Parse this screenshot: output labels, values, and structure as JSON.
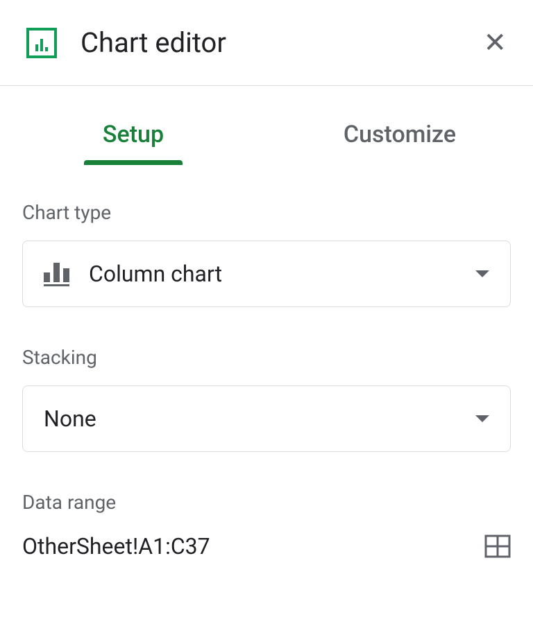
{
  "header": {
    "title": "Chart editor"
  },
  "tabs": {
    "setup": "Setup",
    "customize": "Customize"
  },
  "sections": {
    "chartType": {
      "label": "Chart type",
      "value": "Column chart"
    },
    "stacking": {
      "label": "Stacking",
      "value": "None"
    },
    "dataRange": {
      "label": "Data range",
      "value": "OtherSheet!A1:C37"
    }
  }
}
